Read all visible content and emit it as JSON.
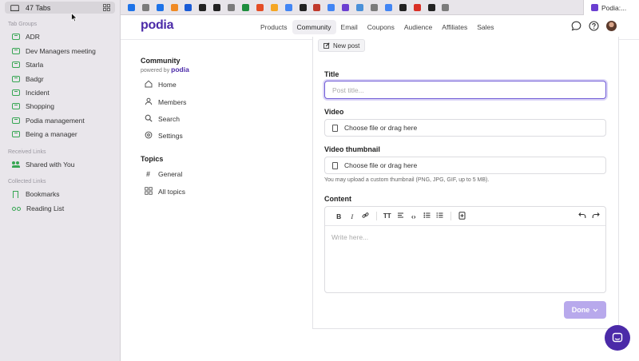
{
  "browser": {
    "tab_count_label": "47 Tabs",
    "sections": {
      "tab_groups": "Tab Groups",
      "received_links": "Received Links",
      "collected_links": "Collected Links"
    },
    "tab_groups": [
      "ADR",
      "Dev Managers meeting",
      "Starla",
      "Badgr",
      "Incident",
      "Shopping",
      "Podia management",
      "Being a manager"
    ],
    "shared_with_you": "Shared with You",
    "bookmarks": "Bookmarks",
    "reading_list": "Reading List",
    "favicon_colors": [
      "#1e73e8",
      "#7b7b7b",
      "#1e73e8",
      "#f08a24",
      "#1a5bd6",
      "#222222",
      "#222222",
      "#7b7b7b",
      "#1e8e3e",
      "#e44d26",
      "#f5a623",
      "#4285f4",
      "#222222",
      "#c0392b",
      "#4285f4",
      "#6b3fd1",
      "#4a90d9",
      "#7b7b7b",
      "#4285f4",
      "#222222",
      "#d93025",
      "#222222",
      "#7b7b7b"
    ],
    "active_tab_title": "Podia:..."
  },
  "app": {
    "logo": "podia",
    "nav": [
      "Products",
      "Community",
      "Email",
      "Coupons",
      "Audience",
      "Affiliates",
      "Sales"
    ],
    "active_nav": "Community",
    "accent_color": "#4b2aa8"
  },
  "community": {
    "title": "Community",
    "powered_by": "powered by",
    "powered_brand": "podia",
    "nav": [
      {
        "label": "Home",
        "icon": "home-icon"
      },
      {
        "label": "Members",
        "icon": "members-icon"
      },
      {
        "label": "Search",
        "icon": "search-icon"
      },
      {
        "label": "Settings",
        "icon": "gear-icon"
      }
    ],
    "topics_title": "Topics",
    "topics": [
      {
        "label": "General",
        "icon": "hash-icon"
      },
      {
        "label": "All topics",
        "icon": "grid-icon"
      }
    ]
  },
  "form": {
    "new_post_label": "New post",
    "title_label": "Title",
    "title_placeholder": "Post title...",
    "video_label": "Video",
    "video_file_text": "Choose file or drag here",
    "thumbnail_label": "Video thumbnail",
    "thumbnail_file_text": "Choose file or drag here",
    "thumbnail_hint": "You may upload a custom thumbnail (PNG, JPG, GIF, up to 5 MB).",
    "content_label": "Content",
    "content_placeholder": "Write here...",
    "done_label": "Done"
  }
}
